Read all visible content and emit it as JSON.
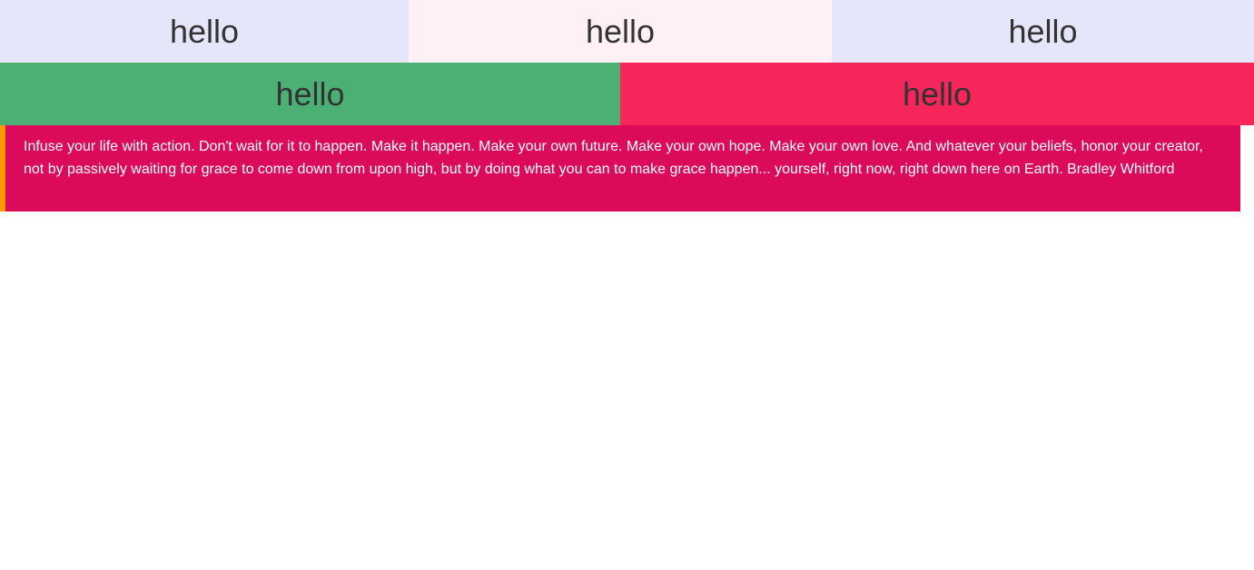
{
  "row1": {
    "cells": [
      "hello",
      "hello",
      "hello"
    ]
  },
  "row2": {
    "cells": [
      "hello",
      "hello"
    ]
  },
  "quote": {
    "text": "Infuse your life with action. Don't wait for it to happen. Make it happen. Make your own future. Make your own hope. Make your own love. And whatever your beliefs, honor your creator, not by passively waiting for grace to come down from upon high, but by doing what you can to make grace happen... yourself, right now, right down here on Earth. Bradley Whitford"
  },
  "colors": {
    "lavender": "#e6e6fa",
    "lavender_blush": "#fff0f5",
    "green": "#4caf74",
    "red": "#f7265a",
    "quote_bg": "#dc0a5b",
    "quote_border": "#ff9900"
  }
}
